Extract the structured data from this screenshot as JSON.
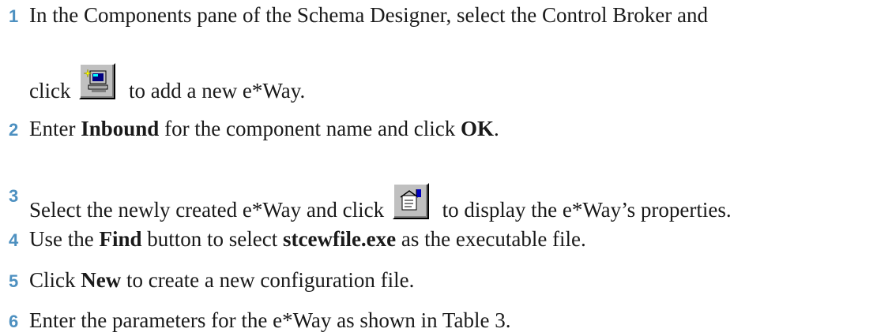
{
  "steps": [
    {
      "number": "1",
      "line1": "In the Components pane of the Schema Designer, select the Control Broker and",
      "line2_prefix": "click",
      "icon": "add-eway-computer-icon",
      "line2_suffix": "to add a new e*Way."
    },
    {
      "number": "2",
      "pre": "Enter ",
      "bold1": "Inbound",
      "mid": " for the component name and click ",
      "bold2": "OK",
      "post": "."
    },
    {
      "number": "3",
      "prefix": "Select the newly created e*Way and click",
      "icon": "properties-icon",
      "suffix": "to display the e*Way’s properties."
    },
    {
      "number": "4",
      "pre": "Use the ",
      "bold1": "Find",
      "mid": " button to select ",
      "bold2": "stcewfile.exe",
      "post": " as the executable file."
    },
    {
      "number": "5",
      "pre": "Click ",
      "bold1": "New",
      "post": " to create a new configuration file."
    },
    {
      "number": "6",
      "text": "Enter the parameters for the e*Way as shown in Table 3."
    }
  ]
}
